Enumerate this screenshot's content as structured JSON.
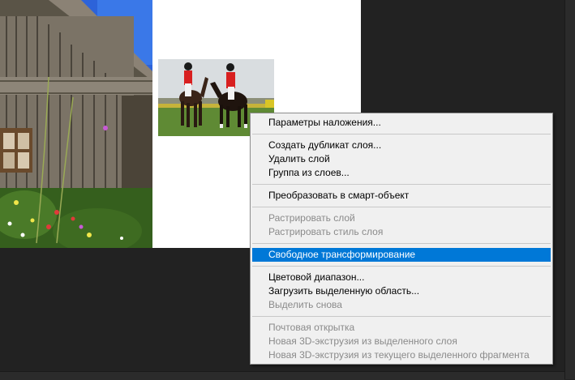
{
  "canvas": {
    "background_color": "#222222",
    "document_color": "#ffffff",
    "layers": [
      {
        "name": "barn-photo",
        "icon": "photo"
      },
      {
        "name": "horses-photo",
        "icon": "photo"
      }
    ]
  },
  "context_menu": {
    "highlight_color": "#0078d7",
    "groups": [
      [
        {
          "label": "Параметры наложения...",
          "enabled": true
        }
      ],
      [
        {
          "label": "Создать дубликат слоя...",
          "enabled": true
        },
        {
          "label": "Удалить слой",
          "enabled": true
        },
        {
          "label": "Группа из слоев...",
          "enabled": true
        }
      ],
      [
        {
          "label": "Преобразовать в смарт-объект",
          "enabled": true
        }
      ],
      [
        {
          "label": "Растрировать слой",
          "enabled": false
        },
        {
          "label": "Растрировать стиль слоя",
          "enabled": false
        }
      ],
      [
        {
          "label": "Свободное трансформирование",
          "enabled": true,
          "highlighted": true
        }
      ],
      [
        {
          "label": "Цветовой диапазон...",
          "enabled": true
        },
        {
          "label": "Загрузить выделенную область...",
          "enabled": true
        },
        {
          "label": "Выделить снова",
          "enabled": false
        }
      ],
      [
        {
          "label": "Почтовая открытка",
          "enabled": false
        },
        {
          "label": "Новая 3D-экструзия из выделенного слоя",
          "enabled": false
        },
        {
          "label": "Новая 3D-экструзия из текущего выделенного фрагмента",
          "enabled": false
        }
      ]
    ]
  }
}
